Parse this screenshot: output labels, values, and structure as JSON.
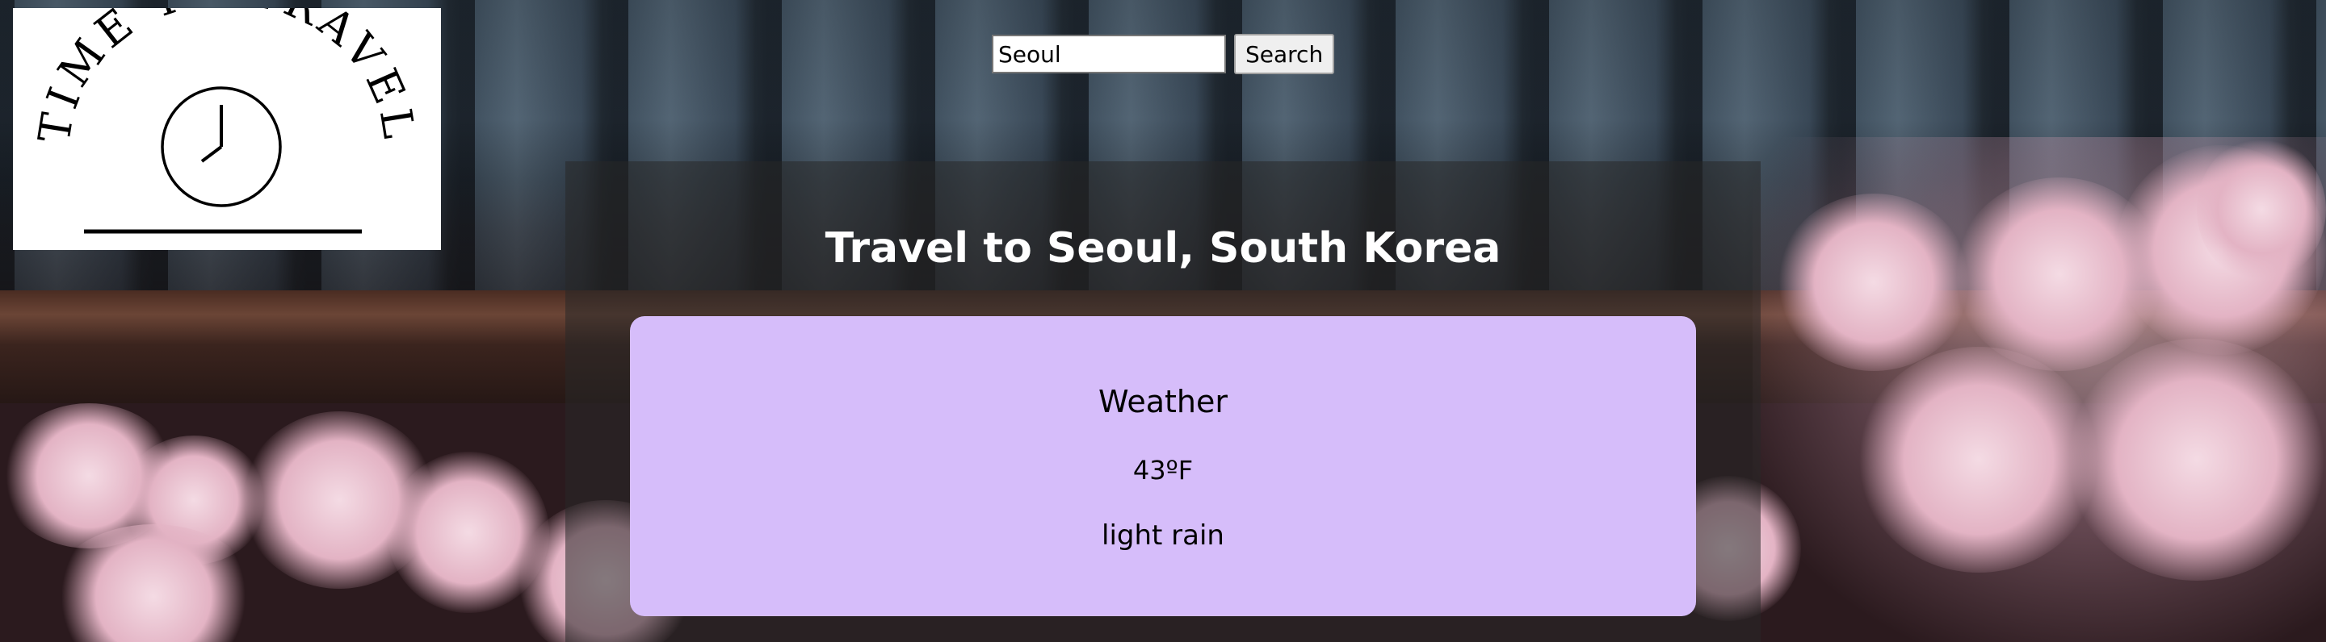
{
  "logo": {
    "text": "TIME TO TRAVEL",
    "icon": "clock-icon"
  },
  "search": {
    "value": "Seoul",
    "button_label": "Search"
  },
  "destination": {
    "title": "Travel to Seoul, South Korea"
  },
  "weather": {
    "heading": "Weather",
    "temperature": "43ºF",
    "description": "light rain"
  },
  "colors": {
    "card_background": "#d6bdfa",
    "title_text": "#ffffff"
  }
}
